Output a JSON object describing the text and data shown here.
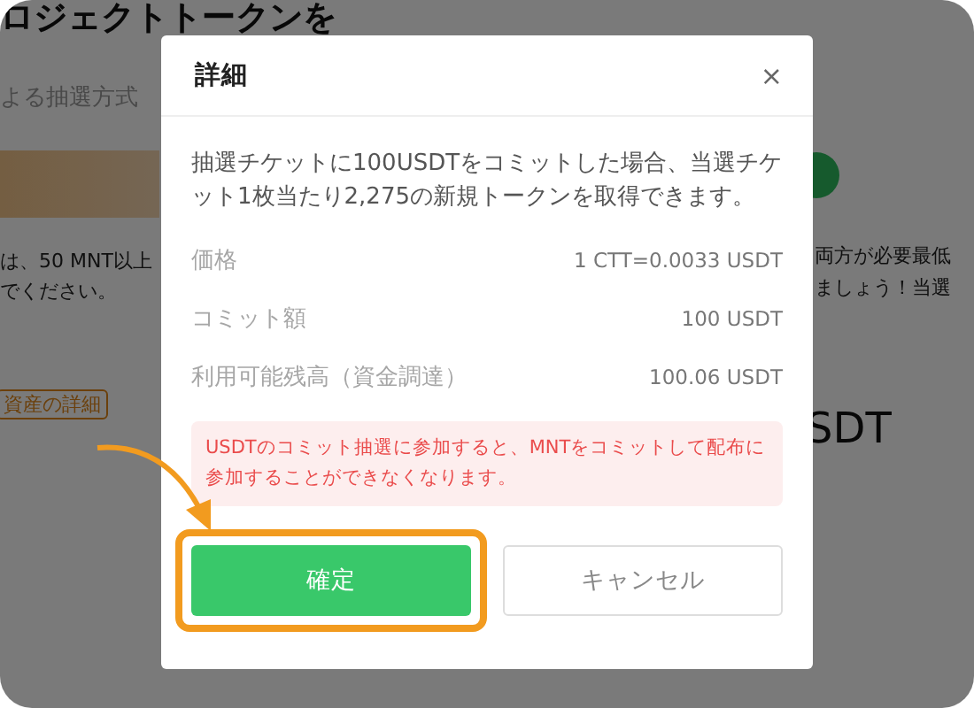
{
  "background": {
    "heading": "ロジェクトトークンを",
    "subheading": "よる抽選方式",
    "left_note": [
      "は、50 MNT以上",
      "でください。"
    ],
    "tag": "資産の詳細",
    "right_note": [
      "両方が必要最低",
      "ましょう！当選"
    ],
    "amount": "SDT"
  },
  "dialog": {
    "title": "詳細",
    "close": "×",
    "description": "抽選チケットに100USDTをコミットした場合、当選チケット1枚当たり2,275の新規トークンを取得できます。",
    "rows": [
      {
        "label": "価格",
        "value": "1 CTT=0.0033 USDT"
      },
      {
        "label": "コミット額",
        "value": "100 USDT"
      },
      {
        "label": "利用可能残高（資金調達）",
        "value": "100.06 USDT"
      }
    ],
    "warning": "USDTのコミット抽選に参加すると、MNTをコミットして配布に参加することができなくなります。",
    "buttons": [
      {
        "kind": "primary",
        "label": "確定",
        "highlighted": true
      },
      {
        "kind": "secondary",
        "label": "キャンセル",
        "highlighted": false
      }
    ]
  }
}
